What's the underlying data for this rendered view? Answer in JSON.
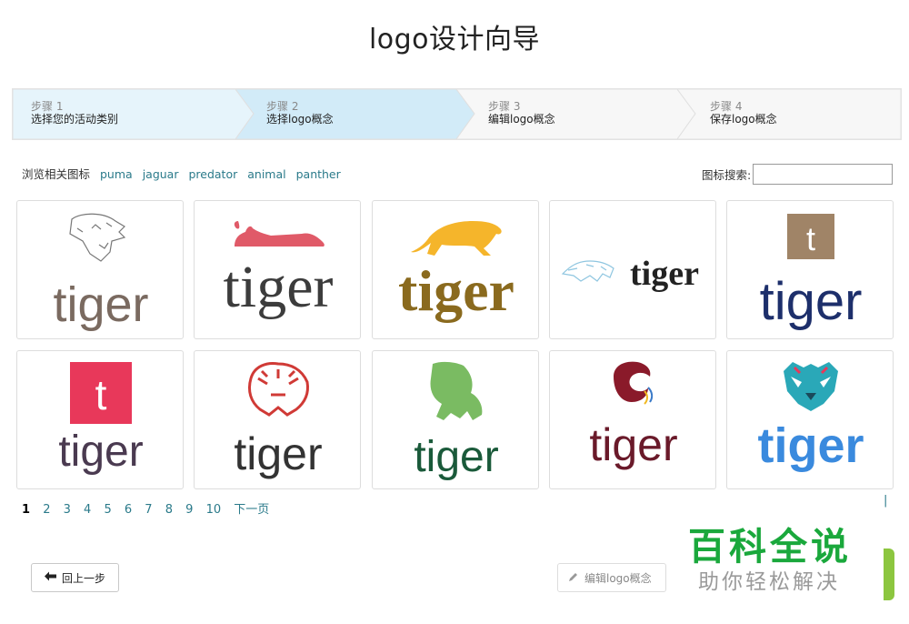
{
  "page": {
    "title": "logo设计向导"
  },
  "steps": [
    {
      "num": "步骤 1",
      "label": "选择您的活动类别"
    },
    {
      "num": "步骤 2",
      "label": "选择logo概念"
    },
    {
      "num": "步骤 3",
      "label": "编辑logo概念"
    },
    {
      "num": "步骤 4",
      "label": "保存logo概念"
    }
  ],
  "browse": {
    "label": "浏览相关图标",
    "tags": [
      "puma",
      "jaguar",
      "predator",
      "animal",
      "panther"
    ]
  },
  "search": {
    "label": "图标搜索:",
    "value": ""
  },
  "logos": [
    {
      "wordmark": "tiger",
      "icon": "roaring-tiger-head-sketch-icon",
      "color": "#7a6a60"
    },
    {
      "wordmark": "tiger",
      "icon": "lying-cat-red-icon",
      "color": "#3c3c3c",
      "accent": "#e05a68"
    },
    {
      "wordmark": "tiger",
      "icon": "jumping-panther-orange-icon",
      "color": "#8a6a1e",
      "accent": "#f5b52b"
    },
    {
      "wordmark": "tiger",
      "icon": "blue-sketch-panther-icon",
      "color": "#222222",
      "accent": "#8fc6e0"
    },
    {
      "wordmark": "tiger",
      "icon": "letter-t-square-icon",
      "letter": "t",
      "color": "#1d2f6b",
      "accent": "#a08467"
    },
    {
      "wordmark": "tiger",
      "icon": "letter-t-square-icon",
      "letter": "t",
      "color": "#4a3a50",
      "accent": "#e8385a"
    },
    {
      "wordmark": "tiger",
      "icon": "red-tribal-tiger-head-icon",
      "color": "#333333",
      "accent": "#d03a36"
    },
    {
      "wordmark": "tiger",
      "icon": "green-crouching-panther-icon",
      "color": "#1a5a3a",
      "accent": "#7abb62"
    },
    {
      "wordmark": "tiger",
      "icon": "shrimp-icon",
      "color": "#6a1a2a",
      "accent": "#8a1a2a"
    },
    {
      "wordmark": "tiger",
      "icon": "teal-geometric-tiger-head-icon",
      "color": "#3a8ade",
      "accent": "#2aa8b8"
    }
  ],
  "pagination": {
    "current": "1",
    "pages": [
      "2",
      "3",
      "4",
      "5",
      "6",
      "7",
      "8",
      "9",
      "10"
    ],
    "next": "下一页"
  },
  "buttons": {
    "back": "回上一步",
    "edit": "编辑logo概念"
  },
  "watermark": {
    "title": "百科全说",
    "subtitle": "助你轻松解决"
  }
}
